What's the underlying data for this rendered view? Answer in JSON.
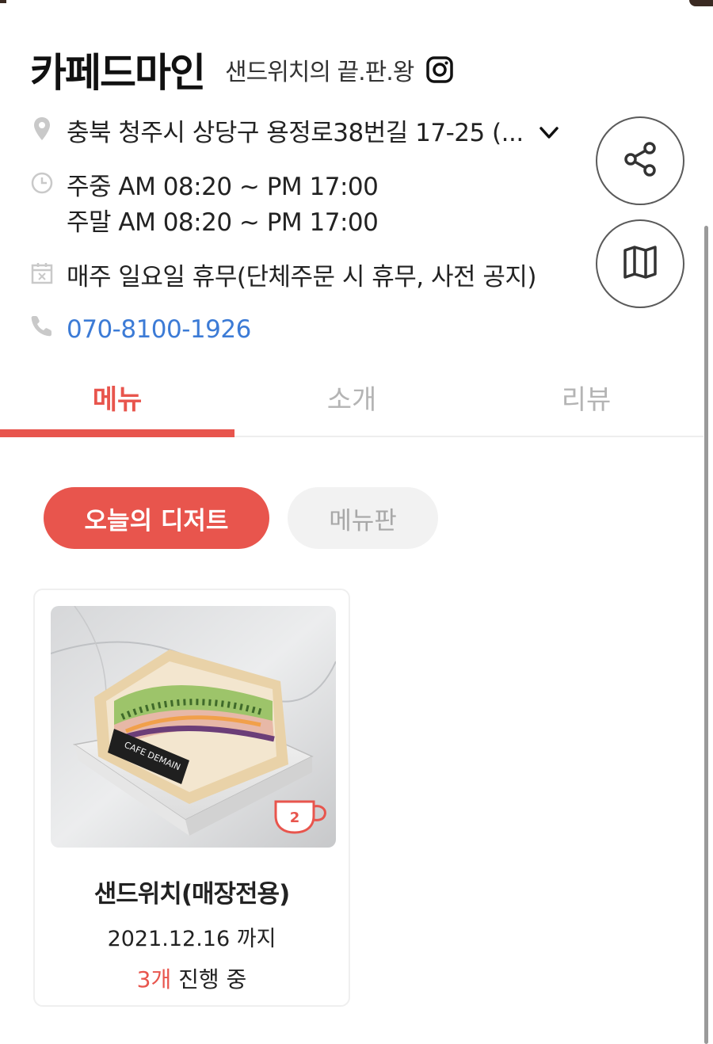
{
  "shop": {
    "name": "카페드마인",
    "tagline": "샌드위치의 끝.판.왕"
  },
  "info": {
    "address": "충북 청주시 상당구 용정로38번길 17-25 (...",
    "hours_weekday": "주중 AM 08:20 ~ PM 17:00",
    "hours_weekend": "주말 AM 08:20 ~ PM 17:00",
    "holiday": "매주 일요일 휴무(단체주문 시 휴무, 사전 공지)",
    "phone": "070-8100-1926"
  },
  "tabs": [
    {
      "label": "메뉴",
      "active": true
    },
    {
      "label": "소개",
      "active": false
    },
    {
      "label": "리뷰",
      "active": false
    }
  ],
  "filters": {
    "active_label": "오늘의 디저트",
    "inactive_label": "메뉴판"
  },
  "menu_card": {
    "title": "샌드위치(매장전용)",
    "date": "2021.12.16 까지",
    "count": "3개",
    "status": " 진행 중",
    "badge_number": "2",
    "box_text": "CAFE DEMAIN"
  },
  "colors": {
    "accent": "#e8554d",
    "link": "#3c7bd6",
    "muted": "#b4b4b4"
  },
  "icons": [
    "instagram-icon",
    "location-pin-icon",
    "chevron-down-icon",
    "clock-icon",
    "calendar-x-icon",
    "phone-icon",
    "share-icon",
    "map-icon",
    "coffee-cup-icon"
  ]
}
